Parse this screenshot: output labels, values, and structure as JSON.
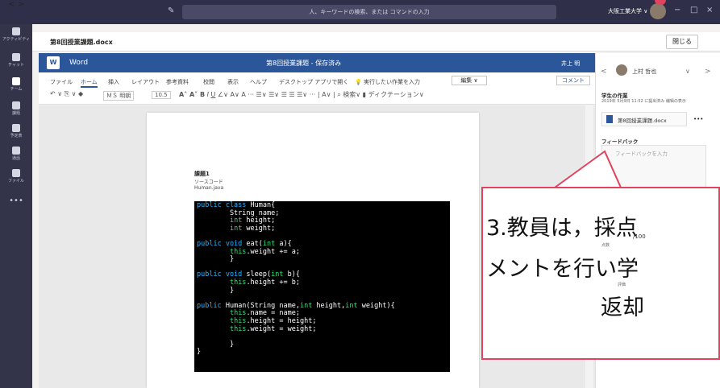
{
  "titlebar": {
    "back": "<",
    "forward": ">",
    "search_placeholder": "人、キーワードの検索、または コマンドの入力",
    "user_label": "大阪工業大学 ∨",
    "minimize": "−",
    "maximize": "□",
    "close": "×"
  },
  "rail": {
    "items": [
      {
        "label": "アクティビティ"
      },
      {
        "label": "チャット"
      },
      {
        "label": "チーム"
      },
      {
        "label": "課題"
      },
      {
        "label": "予定表"
      },
      {
        "label": "通話"
      },
      {
        "label": "ファイル"
      }
    ],
    "more": "•••"
  },
  "doc": {
    "title": "第8回授業課題.docx",
    "close_label": "閉じる"
  },
  "word": {
    "app_name": "Word",
    "doc_title": "第8回授業課題",
    "saved_status": "保存済み",
    "user": "井上 明"
  },
  "ribbon": {
    "tabs": [
      "ファイル",
      "ホーム",
      "挿入",
      "レイアウト",
      "参考資料",
      "校閲",
      "表示",
      "ヘルプ",
      "デスクトップ アプリで開く",
      "実行したい作業を入力"
    ],
    "edit_label": "編集 ∨",
    "comment_label": "コメント",
    "font_name": "ＭＳ 明朝",
    "font_size": "10.5",
    "tools": "↶ ∨  ⎘ ∨  ◆   A˄  A˅   B   I   U   ∠ ∨  A ∨  A   ···   ☰ ∨  ☰ ∨   ☰ ∨   ···   ⌕ 検索 ∨   ▮ ディクテーション ∨"
  },
  "document": {
    "heading1": "課題1",
    "heading2": "ソースコード",
    "heading3": "Human.java"
  },
  "panel": {
    "student_name": "上村 哲也",
    "work_title": "学生の作業",
    "work_date": "2019年 5月9日 11:52 に提出済み  编辑の表示",
    "file_name": "第8回授業課題.docx",
    "feedback_label": "フィードバック",
    "feedback_placeholder": "フィードバックを入力",
    "points_label": "点数",
    "points_value": "/100",
    "rubric_label": "評価"
  },
  "callout": {
    "line1": "3.教員は，採点",
    "line2": "メントを行い学",
    "line3": "返却"
  }
}
